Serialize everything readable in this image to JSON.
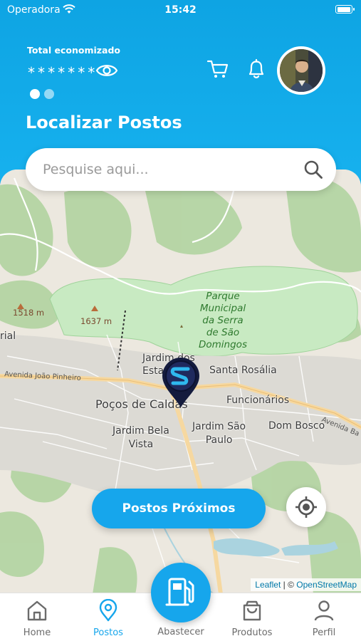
{
  "status": {
    "carrier": "Operadora",
    "time": "15:42"
  },
  "header": {
    "total_label": "Total economizado",
    "total_value": "*******",
    "section_title": "Localizar Postos"
  },
  "search": {
    "placeholder": "Pesquise aqui..."
  },
  "map": {
    "labels": {
      "park": "Parque\nMunicipal\nda Serra\nde São\nDomingos",
      "city": "Poços de Caldas",
      "jardim_estados": "Jardim dos\nEstados",
      "santa_rosalia": "Santa Rosália",
      "funcionarios": "Funcionários",
      "jardim_bela_vista": "Jardim Bela\nVista",
      "jardim_sao_paulo": "Jardim São\nPaulo",
      "dom_bosco": "Dom Bosco",
      "industrial": "rial",
      "elev1": "1518 m",
      "elev2": "1637 m",
      "road_joao_pinheiro": "Avenida João Pinheiro",
      "road_right": "Avenida Ba"
    },
    "attribution": {
      "leaflet": "Leaflet",
      "separator": " | © ",
      "osm": "OpenStreetMap"
    },
    "nearby_button": "Postos Próximos"
  },
  "tabbar": {
    "items": [
      {
        "label": "Home",
        "icon": "home-icon"
      },
      {
        "label": "Postos",
        "icon": "location-pin-icon"
      },
      {
        "label": "Abastecer",
        "icon": "fuel-pump-icon"
      },
      {
        "label": "Produtos",
        "icon": "shopping-bag-icon"
      },
      {
        "label": "Perfil",
        "icon": "user-icon"
      }
    ],
    "active_index": 1
  },
  "colors": {
    "primary": "#16a6ec",
    "header": "#0ea4e3",
    "park": "#c8eac2",
    "tab_inactive": "#6b6b6b"
  }
}
